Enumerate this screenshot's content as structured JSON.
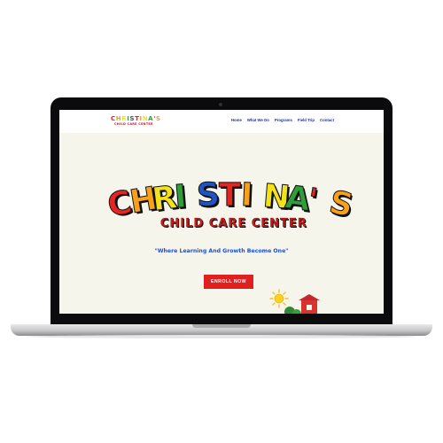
{
  "site": {
    "logo": {
      "word": "CHRISTINA'S",
      "sub": "CHILD CARE CENTER"
    },
    "nav": [
      "Home",
      "What We Do",
      "Programs",
      "Field Trip",
      "Contact"
    ],
    "hero": {
      "title_letters": [
        {
          "ch": "C",
          "color": "#e52521"
        },
        {
          "ch": "H",
          "color": "#f6a01c"
        },
        {
          "ch": "R",
          "color": "#f2e21b"
        },
        {
          "ch": "I",
          "color": "#2f9d3a"
        },
        {
          "ch": "S",
          "color": "#1e54c6"
        },
        {
          "ch": "T",
          "color": "#e52521"
        },
        {
          "ch": "I",
          "color": "#f6a01c"
        },
        {
          "ch": "N",
          "color": "#f2e21b"
        },
        {
          "ch": "A",
          "color": "#2f9d3a"
        },
        {
          "ch": "'",
          "color": "#e52521"
        },
        {
          "ch": "S",
          "color": "#f6a01c"
        }
      ],
      "subtitle": "CHILD CARE CENTER",
      "tagline": "\"Where Learning And Growth Become One\"",
      "cta": "ENROLL NOW"
    }
  },
  "colors": {
    "screen_bg": "#f6f5ec",
    "nav_text": "#23319c",
    "cta_bg": "#e0201f",
    "tagline": "#1e4fd6"
  }
}
